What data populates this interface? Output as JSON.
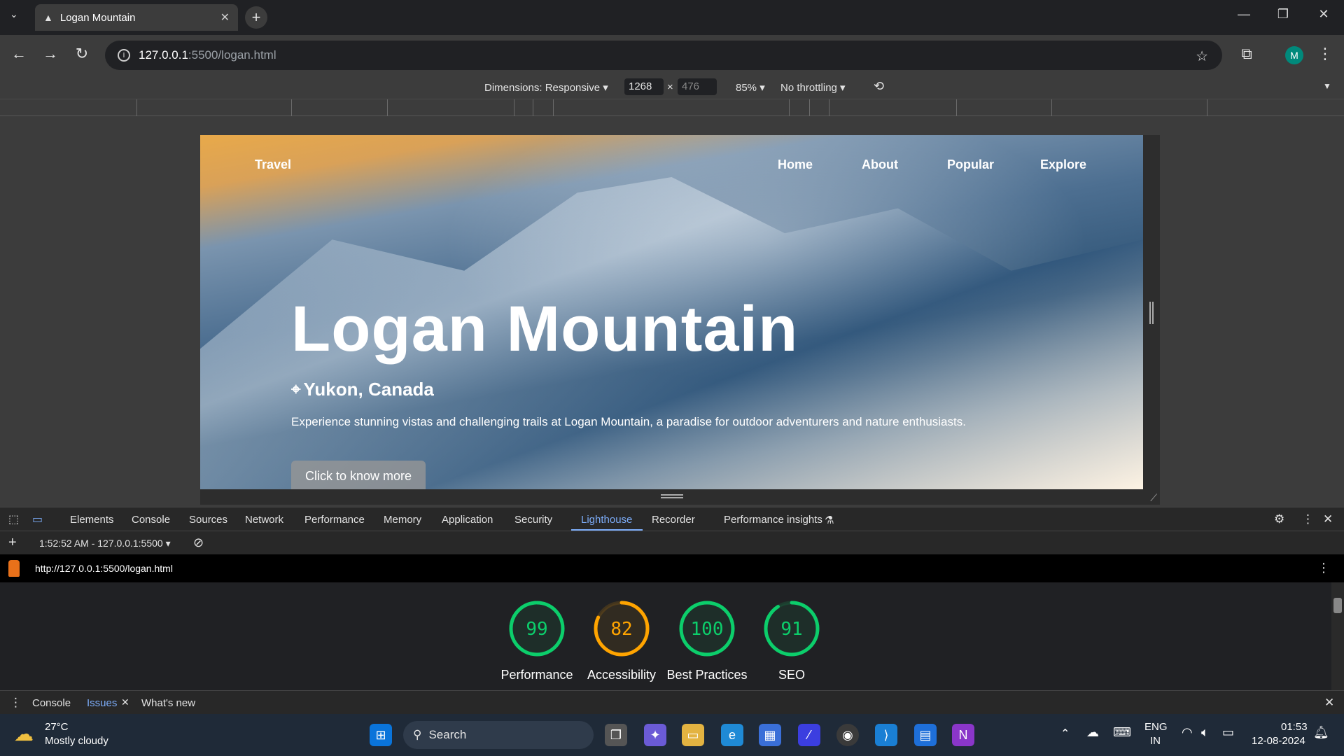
{
  "browser": {
    "tab_title": "Logan Mountain",
    "url_host": "127.0.0.1",
    "url_path": ":5500/logan.html",
    "profile_initial": "M"
  },
  "device_toolbar": {
    "dimensions_label": "Dimensions: Responsive ▾",
    "width": "1268",
    "height": "476",
    "zoom": "85% ▾",
    "throttling": "No throttling ▾"
  },
  "page": {
    "brand": "Travel",
    "nav": [
      "Home",
      "About",
      "Popular",
      "Explore"
    ],
    "title": "Logan Mountain",
    "location": "Yukon, Canada",
    "description": "Experience stunning vistas and challenging trails at Logan Mountain, a paradise for outdoor adventurers and nature enthusiasts.",
    "cta": "Click to know more"
  },
  "devtools": {
    "tabs": [
      "Elements",
      "Console",
      "Sources",
      "Network",
      "Performance",
      "Memory",
      "Application",
      "Security",
      "Lighthouse",
      "Recorder",
      "Performance insights"
    ],
    "active_tab": "Lighthouse",
    "report_selector": "1:52:52 AM - 127.0.0.1:5500 ▾",
    "report_url": "http://127.0.0.1:5500/logan.html",
    "scores": [
      {
        "label": "Performance",
        "score": "99",
        "value": 0.99,
        "color": "#0cce6b"
      },
      {
        "label": "Accessibility",
        "score": "82",
        "value": 0.82,
        "color": "#ffa400"
      },
      {
        "label": "Best Practices",
        "score": "100",
        "value": 1.0,
        "color": "#0cce6b"
      },
      {
        "label": "SEO",
        "score": "91",
        "value": 0.91,
        "color": "#0cce6b"
      }
    ],
    "drawer_tabs": [
      "Console",
      "Issues",
      "What's new"
    ],
    "drawer_active": "Issues"
  },
  "taskbar": {
    "weather_temp": "27°C",
    "weather_desc": "Mostly cloudy",
    "search_placeholder": "Search",
    "lang": "ENG",
    "region": "IN",
    "time": "01:53",
    "date": "12-08-2024"
  }
}
